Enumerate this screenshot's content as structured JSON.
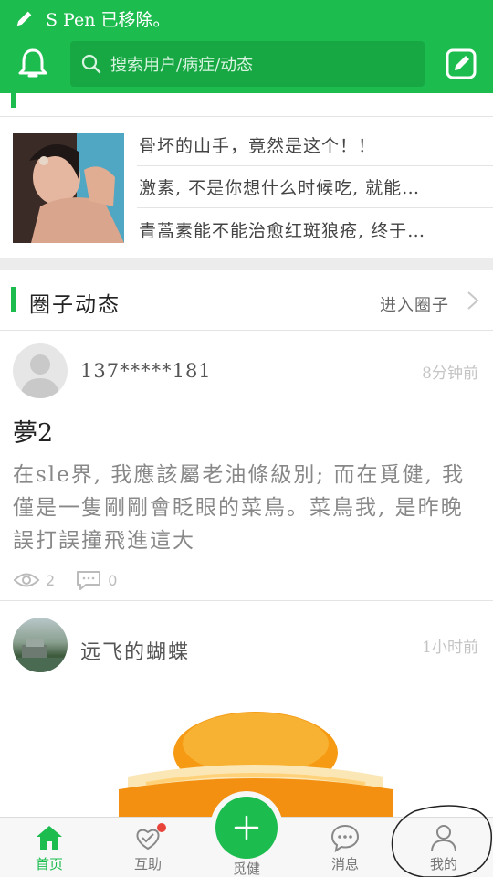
{
  "status_bar": {
    "text": "S Pen 已移除。"
  },
  "header": {
    "search_placeholder": "搜索用户/病症/动态"
  },
  "health_news": {
    "items": [
      "骨坏的山手，竟然是这个！！",
      "激素, 不是你想什么时候吃, 就能…",
      "青蒿素能不能治愈红斑狼疮, 终于…"
    ]
  },
  "circle": {
    "title": "圈子动态",
    "enter_label": "进入圈子",
    "posts": [
      {
        "user": "137*****181",
        "time": "8分钟前",
        "title": "夢2",
        "body": "在sle界, 我應該屬老油條級別; 而在覓健, 我僅是一隻剛剛會眨眼的菜鳥。菜鳥我, 是昨晚誤打誤撞飛進這大",
        "views": "2",
        "comments": "0"
      },
      {
        "user": "远飞的蝴蝶",
        "time": "1小时前"
      }
    ]
  },
  "tabbar": {
    "tabs": [
      "首页",
      "互助",
      "觅健",
      "消息",
      "我的"
    ]
  },
  "colors": {
    "brand_green": "#1cbc4f",
    "badge_red": "#e8443a"
  }
}
